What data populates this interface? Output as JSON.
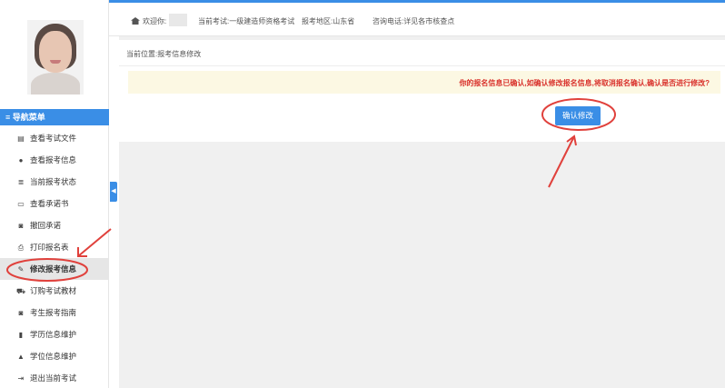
{
  "header": {
    "welcome_label": "欢迎你:",
    "exam_label": "当前考试:一级建造师资格考试",
    "region_label": "报考地区:山东省",
    "phone_label": "咨询电话:详见各市核查点"
  },
  "breadcrumb": "当前位置:报考信息修改",
  "notice": "你的报名信息已确认,如确认修改报名信息,将取消报名确认,确认是否进行修改?",
  "confirm_button": "确认修改",
  "nav": {
    "header": "≡ 导航菜单",
    "items": [
      {
        "label": "查看考试文件",
        "icon": "document-icon",
        "glyph": "▤"
      },
      {
        "label": "查看报考信息",
        "icon": "info-icon",
        "glyph": "●"
      },
      {
        "label": "当前报考状态",
        "icon": "list-icon",
        "glyph": "≣"
      },
      {
        "label": "查看承诺书",
        "icon": "card-icon",
        "glyph": "▭"
      },
      {
        "label": "撤回承诺",
        "icon": "book-icon",
        "glyph": "◙"
      },
      {
        "label": "打印报名表",
        "icon": "print-icon",
        "glyph": "⎙"
      },
      {
        "label": "修改报考信息",
        "icon": "edit-icon",
        "glyph": "✎"
      },
      {
        "label": "订购考试教材",
        "icon": "cart-icon",
        "glyph": "⛟"
      },
      {
        "label": "考生报考指南",
        "icon": "guide-book-icon",
        "glyph": "◙"
      },
      {
        "label": "学历信息维护",
        "icon": "file-icon",
        "glyph": "▮"
      },
      {
        "label": "学位信息维护",
        "icon": "graduation-cap-icon",
        "glyph": "▲"
      },
      {
        "label": "退出当前考试",
        "icon": "logout-icon",
        "glyph": "⇥"
      }
    ]
  },
  "colors": {
    "accent": "#3a8ee6",
    "notice_bg": "#fcf8e3",
    "notice_text": "#d9312b",
    "annotation": "#e0413c"
  }
}
